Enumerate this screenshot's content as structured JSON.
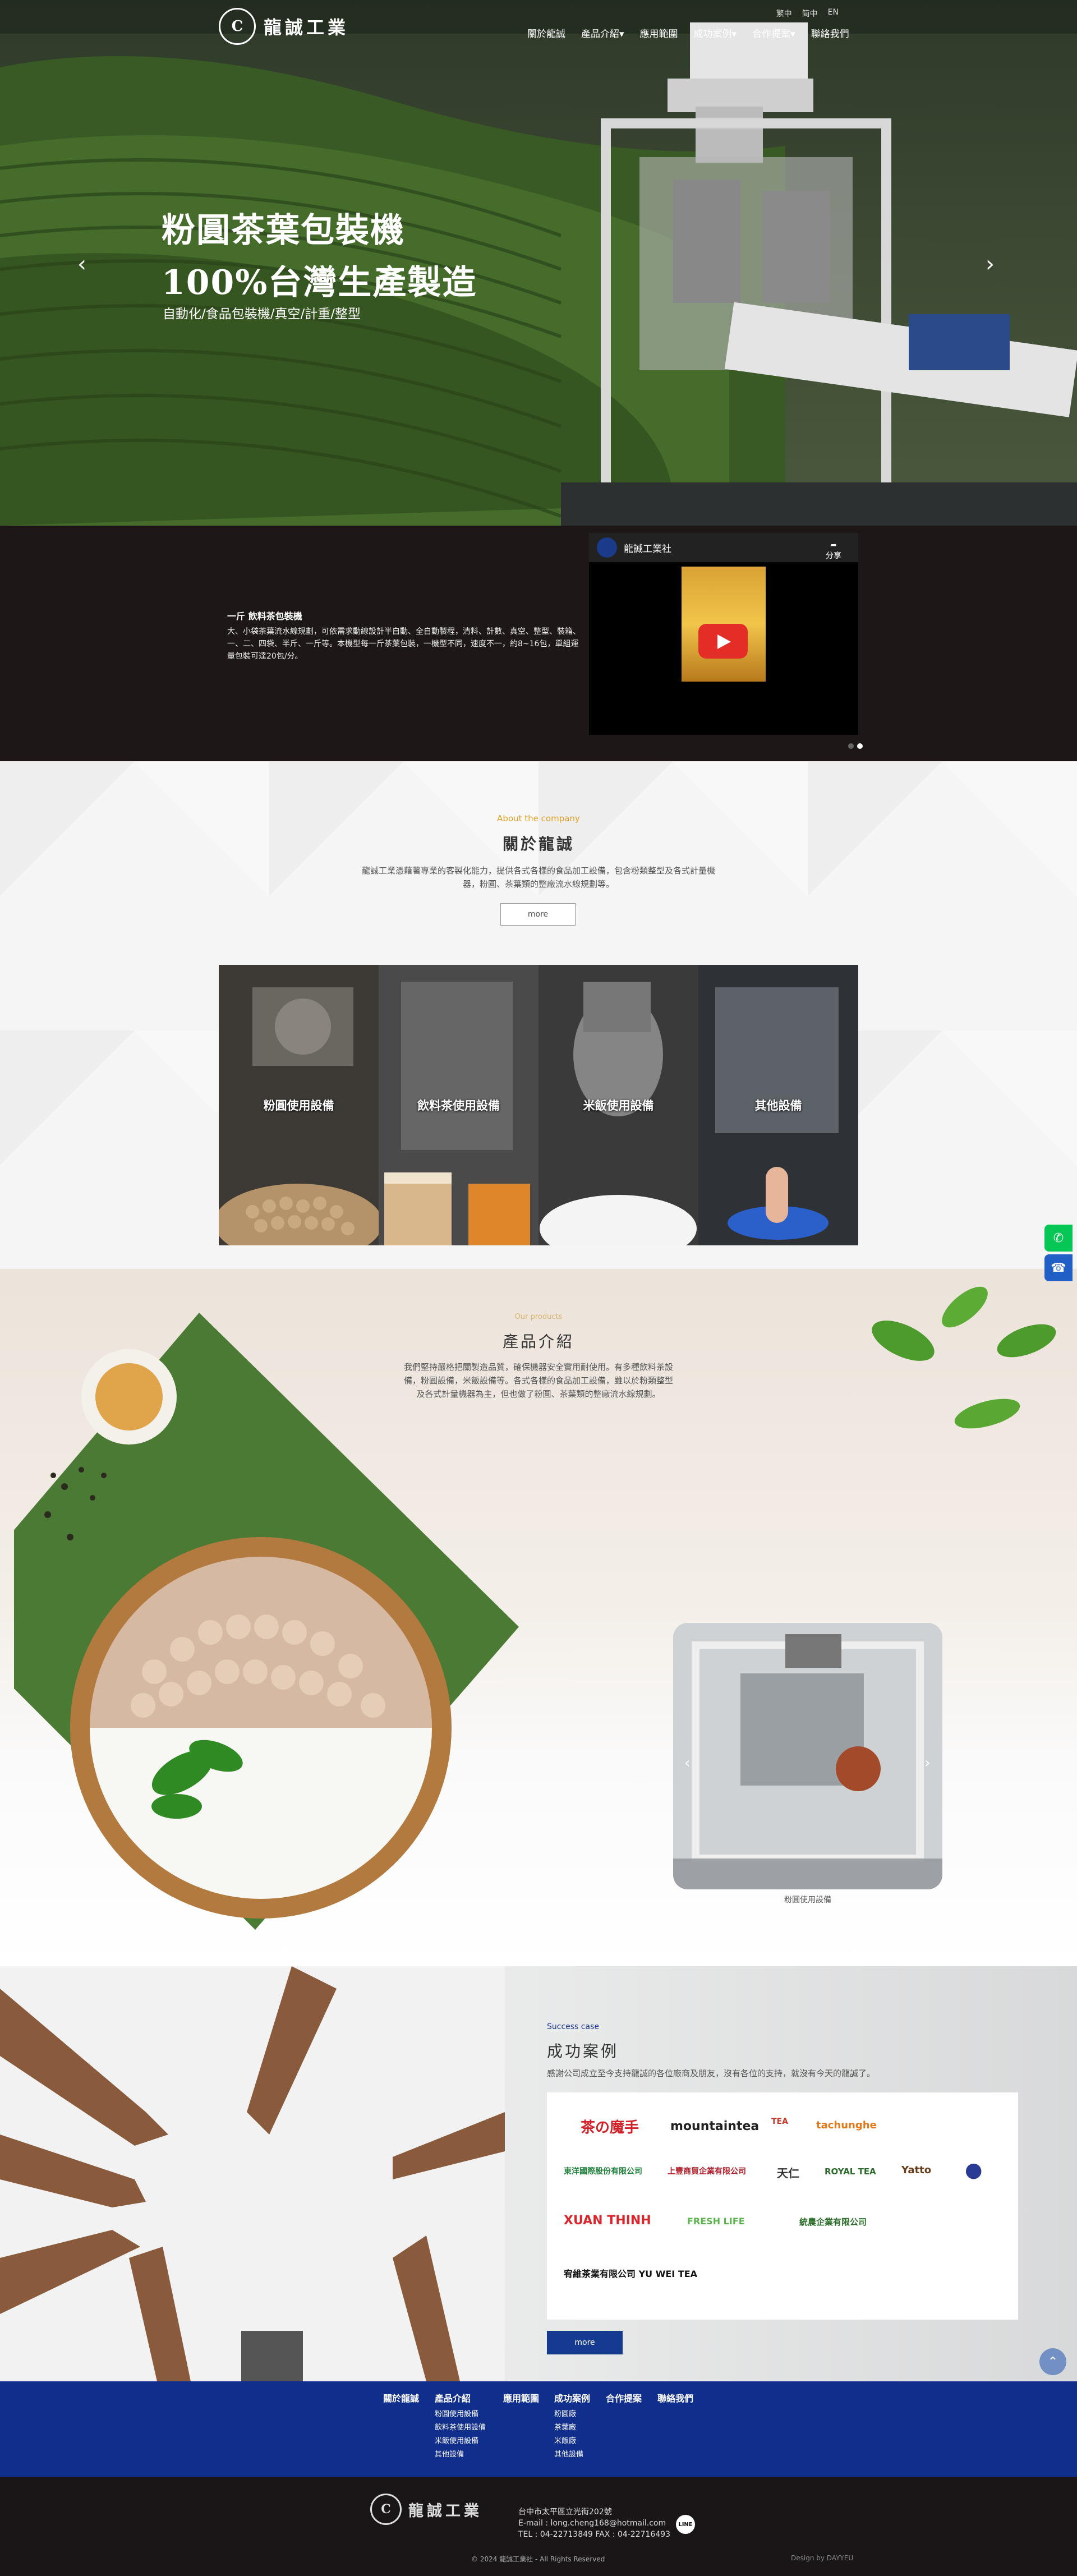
{
  "header": {
    "logo_mark": "C",
    "brand": "龍誠工業",
    "top_links": [
      "繁中",
      "简中",
      "EN"
    ],
    "menu": [
      "關於龍誠",
      "產品介紹",
      "應用範圍",
      "成功案例",
      "合作提案",
      "聯絡我們"
    ],
    "menu_dropdown_flags": [
      false,
      true,
      false,
      true,
      true,
      false
    ]
  },
  "hero": {
    "title_line1": "粉圓茶葉包裝機",
    "title_line2": "100%台灣生產製造",
    "subtitle": "自動化/食品包裝機/真空/計重/整型",
    "prev_icon": "‹",
    "next_icon": "›"
  },
  "intro": {
    "heading": "一斤 飲料茶包裝機",
    "text": "大、小袋茶葉流水線規劃，可依需求動線設計半自動、全自動製程，清料、計數、真空、整型、裝箱、一、二、四袋、半斤、一斤等。本機型每一斤茶葉包裝，一機型不同，速度不一，約8~16包，單組運量包裝可達20包/分。",
    "video_title": "龍誠工業社",
    "video_share": "分享",
    "slide_count": 2,
    "slide_active": 1
  },
  "about": {
    "en": "About the company",
    "title": "關於龍誠",
    "text": "龍誠工業憑藉著專業的客製化能力，提供各式各樣的食品加工設備，包含粉類整型及各式計量機器，粉圓、茶葉類的整廠流水線規劃等。",
    "more": "more",
    "categories": [
      "粉圓使用設備",
      "飲料茶使用設備",
      "米飯使用設備",
      "其他設備"
    ]
  },
  "products": {
    "en": "Our products",
    "title": "產品介紹",
    "text": "我們堅持嚴格把關製造品質，確保機器安全實用耐使用。有多種飲料茶設備，粉圓設備，米飯設備等。各式各樣的食品加工設備，雖以於粉類整型及各式計量機器為主，但也做了粉圓、茶葉類的整廠流水線規劃。",
    "card_label": "粉圓使用設備"
  },
  "success": {
    "en": "Success case",
    "title": "成功案例",
    "text": "感謝公司成立至今支持龍誠的各位廠商及朋友，沒有各位的支持，就沒有今天的龍誠了。",
    "brands": [
      "茶の魔手",
      "mountaintea",
      "TEA",
      "tachunghe",
      "東洋國際股份有限公司",
      "上豐商貿企業有限公司",
      "天仁",
      "ROYAL TEA",
      "Yatto",
      "●",
      "XUAN THINH",
      "FRESH LIFE",
      "統農企業有限公司",
      "宥維茶業有限公司 YU WEI TEA"
    ],
    "more": "more"
  },
  "footer": {
    "columns": [
      {
        "title": "關於龍誠",
        "items": []
      },
      {
        "title": "產品介紹",
        "items": [
          "粉圓使用設備",
          "飲料茶使用設備",
          "米飯使用設備",
          "其他設備"
        ]
      },
      {
        "title": "應用範圍",
        "items": []
      },
      {
        "title": "成功案例",
        "items": [
          "粉圓廠",
          "茶葉廠",
          "米飯廠",
          "其他設備"
        ]
      },
      {
        "title": "合作提案",
        "items": []
      },
      {
        "title": "聯絡我們",
        "items": []
      }
    ],
    "address": "台中市太平區立光街202號",
    "email": "E-mail : long.cheng168@hotmail.com",
    "phone": "TEL : 04-22713849 FAX : 04-22716493",
    "line": "LINE",
    "copyright": "© 2024 龍誠工業社 - All Rights Reserved",
    "design": "Design by DAYYEU"
  },
  "colors": {
    "accent": "#102e8c",
    "gold": "#e0a020",
    "line": "#06c755",
    "phone": "#1f5fc6"
  }
}
